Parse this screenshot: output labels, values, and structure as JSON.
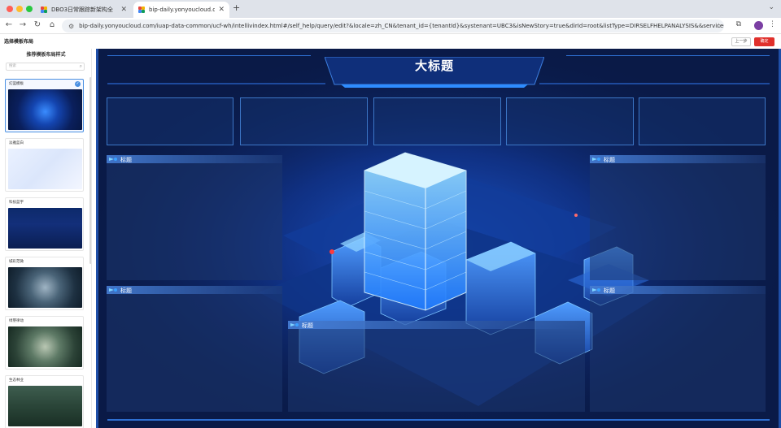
{
  "browser": {
    "tabs": [
      {
        "title": "DBO3日常跟踪新架构全",
        "active": false
      },
      {
        "title": "bip-daily.yonyoucloud.com/",
        "active": true
      }
    ],
    "url": "bip-daily.yonyoucloud.com/iuap-data-common/ucf-wh/intellivindex.html#/self_help/query/edit?&locale=zh_CN&tenant_id={tenantId}&systenant=UBC3&isNewStory=true&dirId=root&listType=DIRSELFHELPANALYSIS&&serviceC..."
  },
  "header": {
    "title": "选择模板布局",
    "prev_label": "上一步",
    "done_label": "确定"
  },
  "sidebar": {
    "heading": "推荐模板布局样式",
    "search_placeholder": "搜索",
    "templates": [
      {
        "label": "幻蓝模板",
        "selected": true
      },
      {
        "label": "淡雅蓝白",
        "selected": false
      },
      {
        "label": "科技蓝宇",
        "selected": false
      },
      {
        "label": "城彩范微",
        "selected": false
      },
      {
        "label": "绿芽律动",
        "selected": false
      },
      {
        "label": "生态林业",
        "selected": false
      }
    ]
  },
  "canvas": {
    "big_title": "大标题",
    "panel_title": "标题"
  },
  "colors": {
    "accent_red": "#e0302b",
    "accent_blue": "#4a90e2",
    "canvas_bg": "#0a1a47"
  }
}
